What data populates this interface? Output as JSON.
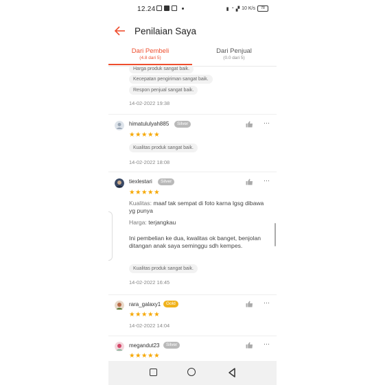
{
  "status_bar": {
    "time": "12.24",
    "net_speed": "10 K/s",
    "battery": "78"
  },
  "header": {
    "title": "Penilaian Saya"
  },
  "tabs": [
    {
      "label": "Dari Pembeli",
      "sub": "(4.8 dari 5)"
    },
    {
      "label": "Dari Penjual",
      "sub": "(0.0 dari 5)"
    }
  ],
  "reviews": [
    {
      "chips": [
        "Harga produk sangat baik.",
        "Kecepatan pengiriman sangat baik.",
        "Respon penjual sangat baik."
      ],
      "date": "14-02-2022 19:38"
    },
    {
      "username": "himatululyah885",
      "badge": "Silver",
      "stars": "★★★★★",
      "chips": [
        "Kualitas produk sangat baik."
      ],
      "date": "14-02-2022 18:08"
    },
    {
      "username": "tiexlestari",
      "badge": "Silver",
      "stars": "★★★★★",
      "quality_label": "Kualitas:",
      "quality_text": "maaf tak sempat di foto karna lgsg dibawa yg punya",
      "price_label": "Harga:",
      "price_text": "terjangkau",
      "comment": "Ini pembelian ke dua, kwalitas ok banget, benjolan ditangan anak saya seminggu sdh kempes.",
      "chips": [
        "Kualitas produk sangat baik."
      ],
      "date": "14-02-2022 16:45"
    },
    {
      "username": "rara_galaxy1",
      "badge": "Gold",
      "stars": "★★★★★",
      "date": "14-02-2022 14:04"
    },
    {
      "username": "megandut23",
      "badge": "Silver",
      "stars": "★★★★★"
    }
  ],
  "icons": {
    "like": "thumbs-up-icon",
    "more": "⋯",
    "back": "←"
  },
  "colors": {
    "accent": "#ee4d2d",
    "star": "#f6a700",
    "gold": "#f0b21b",
    "silver": "#b9b9b9"
  }
}
